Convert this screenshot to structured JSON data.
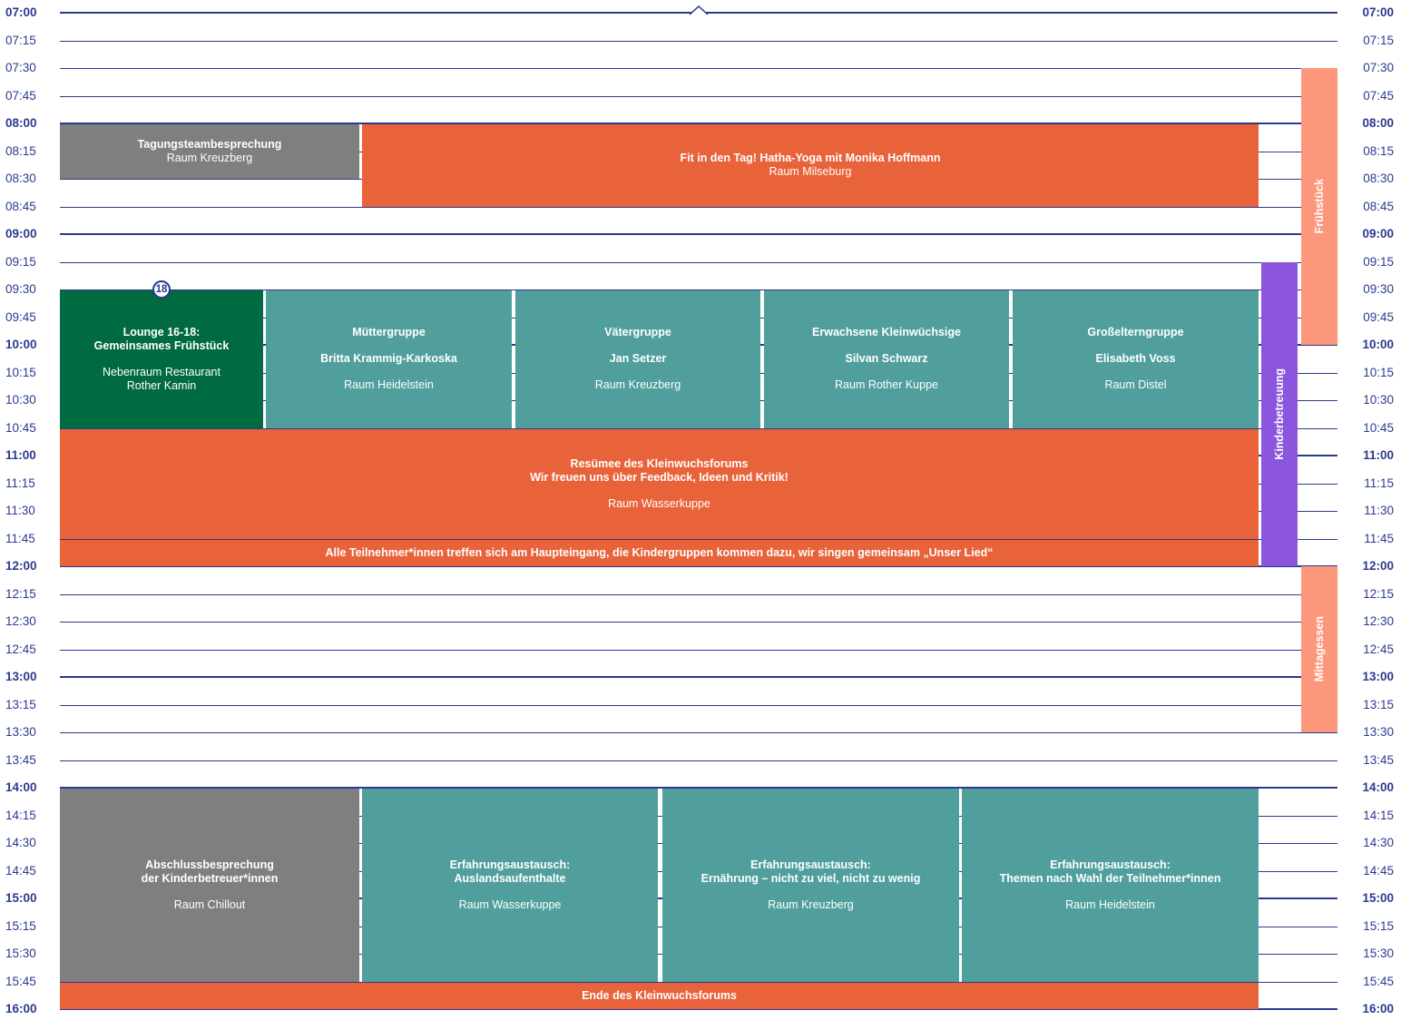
{
  "times": [
    "07:00",
    "07:15",
    "07:30",
    "07:45",
    "08:00",
    "08:15",
    "08:30",
    "08:45",
    "09:00",
    "09:15",
    "09:30",
    "09:45",
    "10:00",
    "10:15",
    "10:30",
    "10:45",
    "11:00",
    "11:15",
    "11:30",
    "11:45",
    "12:00",
    "12:15",
    "12:30",
    "12:45",
    "13:00",
    "13:15",
    "13:30",
    "13:45",
    "14:00",
    "14:15",
    "14:30",
    "14:45",
    "15:00",
    "15:15",
    "15:30",
    "15:45",
    "16:00"
  ],
  "events": [
    {
      "title": "Tagungsteambesprechung",
      "room": "Raum Kreuzberg",
      "color": "#7f7f7f"
    },
    {
      "title": "Fit in den Tag! Hatha-Yoga mit Monika Hoffmann",
      "room": "Raum Milseburg",
      "color": "#e8623a"
    },
    {
      "title": "Lounge 16-18:\nGemeinsames Frühstück",
      "room": "Nebenraum Restaurant\nRother Kamin",
      "color": "#006a43",
      "badge": "18"
    },
    {
      "title": "Müttergruppe",
      "person": "Britta Krammig-Karkoska",
      "room": "Raum Heidelstein",
      "color": "#509f9c"
    },
    {
      "title": "Vätergruppe",
      "person": "Jan Setzer",
      "room": "Raum Kreuzberg",
      "color": "#509f9c"
    },
    {
      "title": "Erwachsene Kleinwüchsige",
      "person": "Silvan Schwarz",
      "room": "Raum Rother Kuppe",
      "color": "#509f9c"
    },
    {
      "title": "Großelterngruppe",
      "person": "Elisabeth Voss",
      "room": "Raum Distel",
      "color": "#509f9c"
    },
    {
      "title": "Resümee des Kleinwuchsforums\nWir freuen uns über Feedback, Ideen und Kritik!",
      "room": "Raum Wasserkuppe",
      "color": "#e8623a"
    },
    {
      "title": "Alle Teilnehmer*innen treffen sich am Haupteingang, die Kindergruppen kommen dazu, wir singen gemeinsam „Unser Lied“",
      "color": "#e8623a"
    },
    {
      "title": "Abschlussbesprechung\nder Kinderbetreuer*innen",
      "room": "Raum Chillout",
      "color": "#7f7f7f"
    },
    {
      "title": "Erfahrungsaustausch:\nAuslandsaufenthalte",
      "room": "Raum Wasserkuppe",
      "color": "#509f9c"
    },
    {
      "title": "Erfahrungsaustausch:\nErnährung – nicht zu viel, nicht zu wenig",
      "room": "Raum Kreuzberg",
      "color": "#509f9c"
    },
    {
      "title": "Erfahrungsaustausch:\nThemen nach Wahl der Teilnehmer*innen",
      "room": "Raum Heidelstein",
      "color": "#509f9c"
    },
    {
      "title": "Ende des Kleinwuchsforums",
      "color": "#e8623a"
    }
  ],
  "sidebars": [
    {
      "label": "Frühstück",
      "color": "#fd977c"
    },
    {
      "label": "Kinderbetreuung",
      "color": "#8b55de"
    },
    {
      "label": "Mittagessen",
      "color": "#fd977c"
    }
  ],
  "colors": {
    "line": "#2b3990",
    "text": "#2b3990"
  }
}
